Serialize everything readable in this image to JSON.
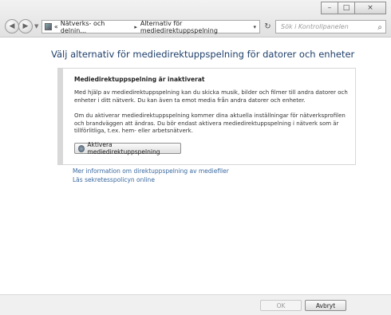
{
  "window": {
    "caption_buttons": {
      "minimize": "–",
      "maximize": "□",
      "close": "×"
    }
  },
  "nav": {
    "back_icon": "◀",
    "forward_icon": "▶",
    "history_dropdown_icon": "▼",
    "breadcrumb": {
      "prefix": "«",
      "items": [
        "Nätverks- och delnin...",
        "Alternativ för mediedirektuppspelning"
      ],
      "separator": "▸"
    },
    "address_dropdown_icon": "▾",
    "refresh_icon": "↻",
    "search": {
      "placeholder": "Sök i Kontrollpanelen",
      "icon": "⌕"
    }
  },
  "main": {
    "title": "Välj alternativ för mediedirektuppspelning för datorer och enheter",
    "info": {
      "heading": "Mediedirektuppspelning är inaktiverat",
      "paragraph1": "Med hjälp av mediedirektuppspelning kan du skicka musik, bilder och filmer till andra datorer och enheter i ditt nätverk. Du kan även ta emot media från andra datorer och enheter.",
      "paragraph2": "Om du aktiverar mediedirektuppspelning kommer dina aktuella inställningar för nätverksprofilen och brandväggen att ändras. Du bör endast aktivera mediedirektuppspelning i nätverk som är tillförlitliga, t.ex. hem- eller arbetsnätverk.",
      "button_label": "Aktivera mediedirektuppspelning"
    },
    "links": [
      "Mer information om direktuppspelning av mediefiler",
      "Läs sekretesspolicyn online"
    ]
  },
  "footer": {
    "ok_label": "OK",
    "cancel_label": "Avbryt"
  }
}
